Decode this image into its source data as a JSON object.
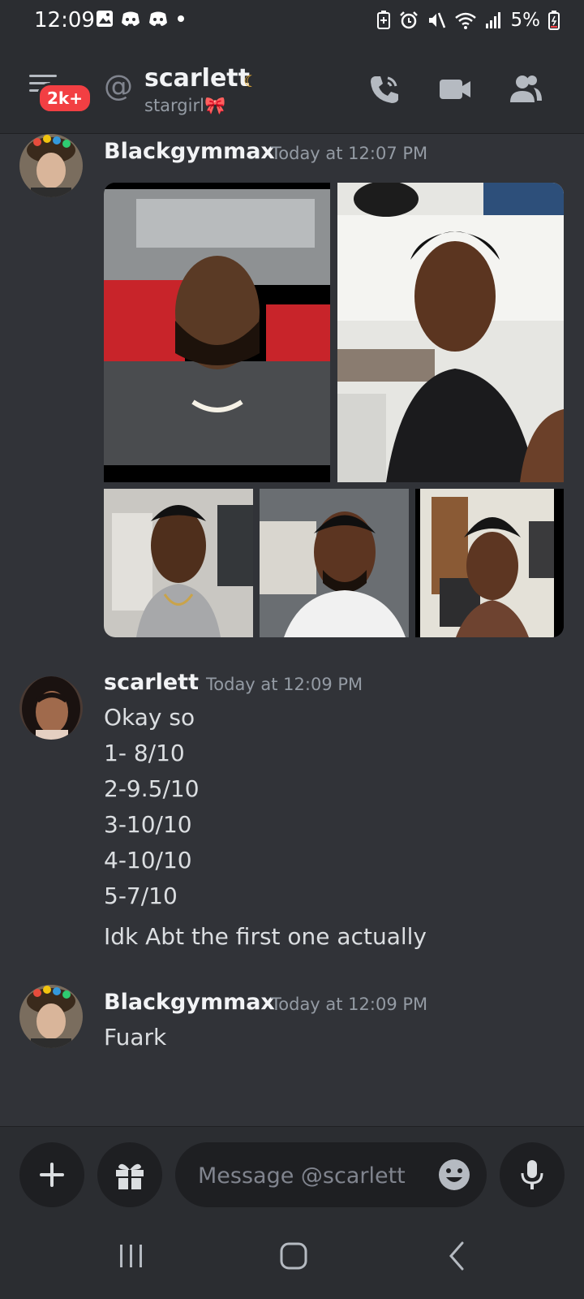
{
  "status_bar": {
    "time": "12:09",
    "battery": "5%",
    "left_icons": [
      "gallery-icon",
      "discord-icon",
      "discord-icon",
      "dot-icon"
    ],
    "right_icons": [
      "battery-saver-icon",
      "alarm-icon",
      "mute-icon",
      "wifi-icon",
      "signal-icon",
      "battery-icon"
    ]
  },
  "header": {
    "badge": "2k+",
    "name": "scarlett",
    "status": "stargirl🎀",
    "icons": [
      "menu-icon",
      "at-icon",
      "moon-icon",
      "call-icon",
      "video-icon",
      "members-icon"
    ]
  },
  "messages": [
    {
      "author": "Blackgymmax",
      "time": "Today at 12:07 PM",
      "lines": [],
      "attachments": 5
    },
    {
      "author": "scarlett",
      "time": "Today at 12:09 PM",
      "lines": [
        "Okay so",
        "1- 8/10",
        "2-9.5/10",
        "3-10/10",
        "4-10/10",
        "5-7/10",
        "Idk Abt the first one actually"
      ]
    },
    {
      "author": "Blackgymmax",
      "time": "Today at 12:09 PM",
      "lines": [
        "Fuark"
      ]
    }
  ],
  "composer": {
    "placeholder": "Message @scarlett",
    "icons": [
      "plus-icon",
      "gift-icon",
      "emoji-icon",
      "mic-icon"
    ]
  },
  "nav": {
    "icons": [
      "recents-icon",
      "home-icon",
      "back-icon"
    ]
  },
  "colors": {
    "background": "#313338",
    "header": "#2b2d31",
    "badge": "#f23f43",
    "input": "#1e1f22"
  }
}
